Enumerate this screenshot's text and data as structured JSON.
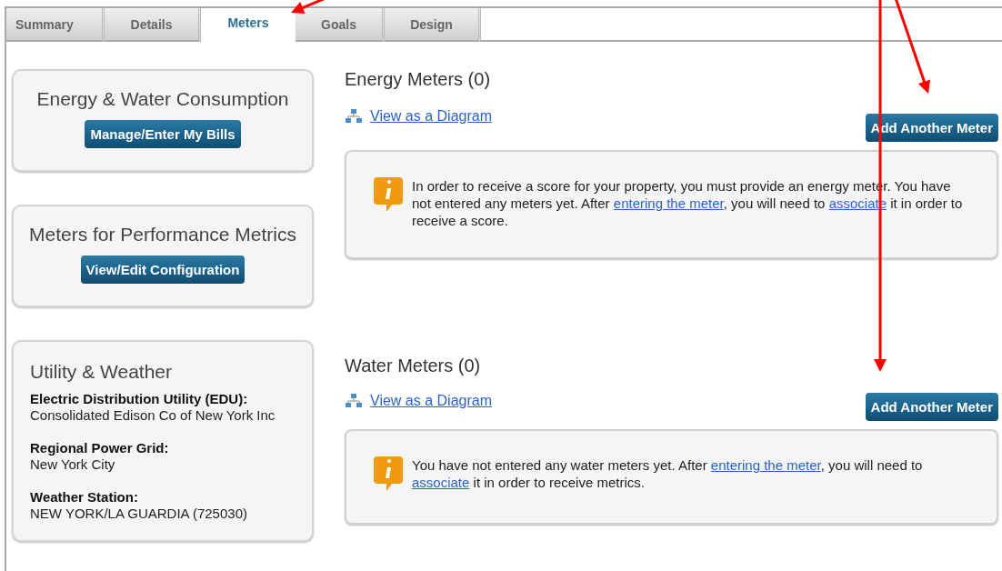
{
  "tabs": [
    {
      "label": "Summary",
      "selected": false
    },
    {
      "label": "Details",
      "selected": false
    },
    {
      "label": "Meters",
      "selected": true
    },
    {
      "label": "Goals",
      "selected": false
    },
    {
      "label": "Design",
      "selected": false
    }
  ],
  "sidebar": [
    {
      "kind": "action",
      "title": "Energy & Water Consumption",
      "button": "Manage/Enter My Bills"
    },
    {
      "kind": "action",
      "title": "Meters for Performance Metrics",
      "button": "View/Edit Configuration"
    },
    {
      "kind": "info",
      "title": "Utility & Weather",
      "fields": [
        {
          "label": "Electric Distribution Utility (EDU):",
          "value": "Consolidated Edison Co of New York Inc"
        },
        {
          "label": "Regional Power Grid:",
          "value": "New York City"
        },
        {
          "label": "Weather Station:",
          "value": "NEW YORK/LA GUARDIA (725030)"
        }
      ]
    }
  ],
  "sections": [
    {
      "heading": "Energy Meters (0)",
      "link": "View as a Diagram",
      "button": "Add Another Meter",
      "message": [
        {
          "kind": "text",
          "text": "In order to receive a score for your property, you must provide an energy meter. You have not entered any meters yet. After "
        },
        {
          "kind": "link",
          "text": "entering the meter"
        },
        {
          "kind": "text",
          "text": ", you will need to "
        },
        {
          "kind": "link",
          "text": "associate"
        },
        {
          "kind": "text",
          "text": " it in order to receive a score."
        }
      ]
    },
    {
      "heading": "Water Meters (0)",
      "link": "View as a Diagram",
      "button": "Add Another Meter",
      "message": [
        {
          "kind": "text",
          "text": "You have not entered any water meters yet. After "
        },
        {
          "kind": "link",
          "text": "entering the meter"
        },
        {
          "kind": "text",
          "text": ", you will need to "
        },
        {
          "kind": "link",
          "text": "associate"
        },
        {
          "kind": "text",
          "text": " it in order to receive metrics."
        }
      ]
    }
  ]
}
